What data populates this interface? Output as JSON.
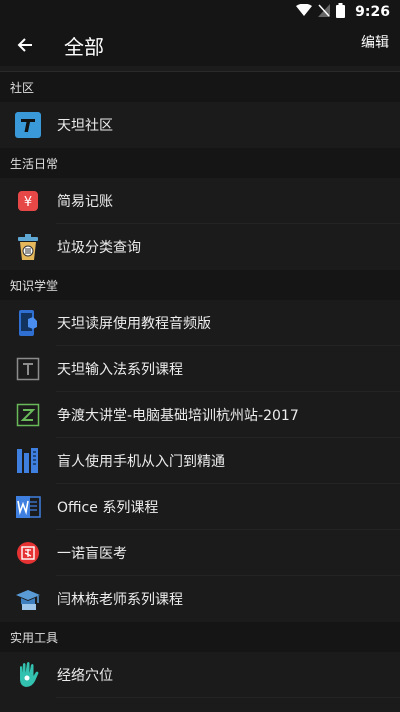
{
  "status_bar": {
    "time": "9:26"
  },
  "app_bar": {
    "title": "全部",
    "edit_label": "编辑"
  },
  "sections": [
    {
      "title": "社区",
      "items": [
        {
          "label": "天坦社区",
          "icon": "tiantan-t-logo-icon"
        }
      ]
    },
    {
      "title": "生活日常",
      "items": [
        {
          "label": "简易记账",
          "icon": "yen-ledger-icon"
        },
        {
          "label": "垃圾分类查询",
          "icon": "trash-bin-icon"
        }
      ]
    },
    {
      "title": "知识学堂",
      "items": [
        {
          "label": "天坦读屏使用教程音频版",
          "icon": "phone-audio-icon"
        },
        {
          "label": "天坦输入法系列课程",
          "icon": "t-square-icon"
        },
        {
          "label": "争渡大讲堂-电脑基础培训杭州站-2017",
          "icon": "z-square-icon"
        },
        {
          "label": "盲人使用手机从入门到精通",
          "icon": "phone-bars-icon"
        },
        {
          "label": "Office 系列课程",
          "icon": "word-doc-icon"
        },
        {
          "label": "一诺盲医考",
          "icon": "medical-yi-icon"
        },
        {
          "label": "闫林栋老师系列课程",
          "icon": "graduation-cap-icon"
        }
      ]
    },
    {
      "title": "实用工具",
      "items": [
        {
          "label": "经络穴位",
          "icon": "hand-acupoint-icon"
        }
      ]
    }
  ]
}
